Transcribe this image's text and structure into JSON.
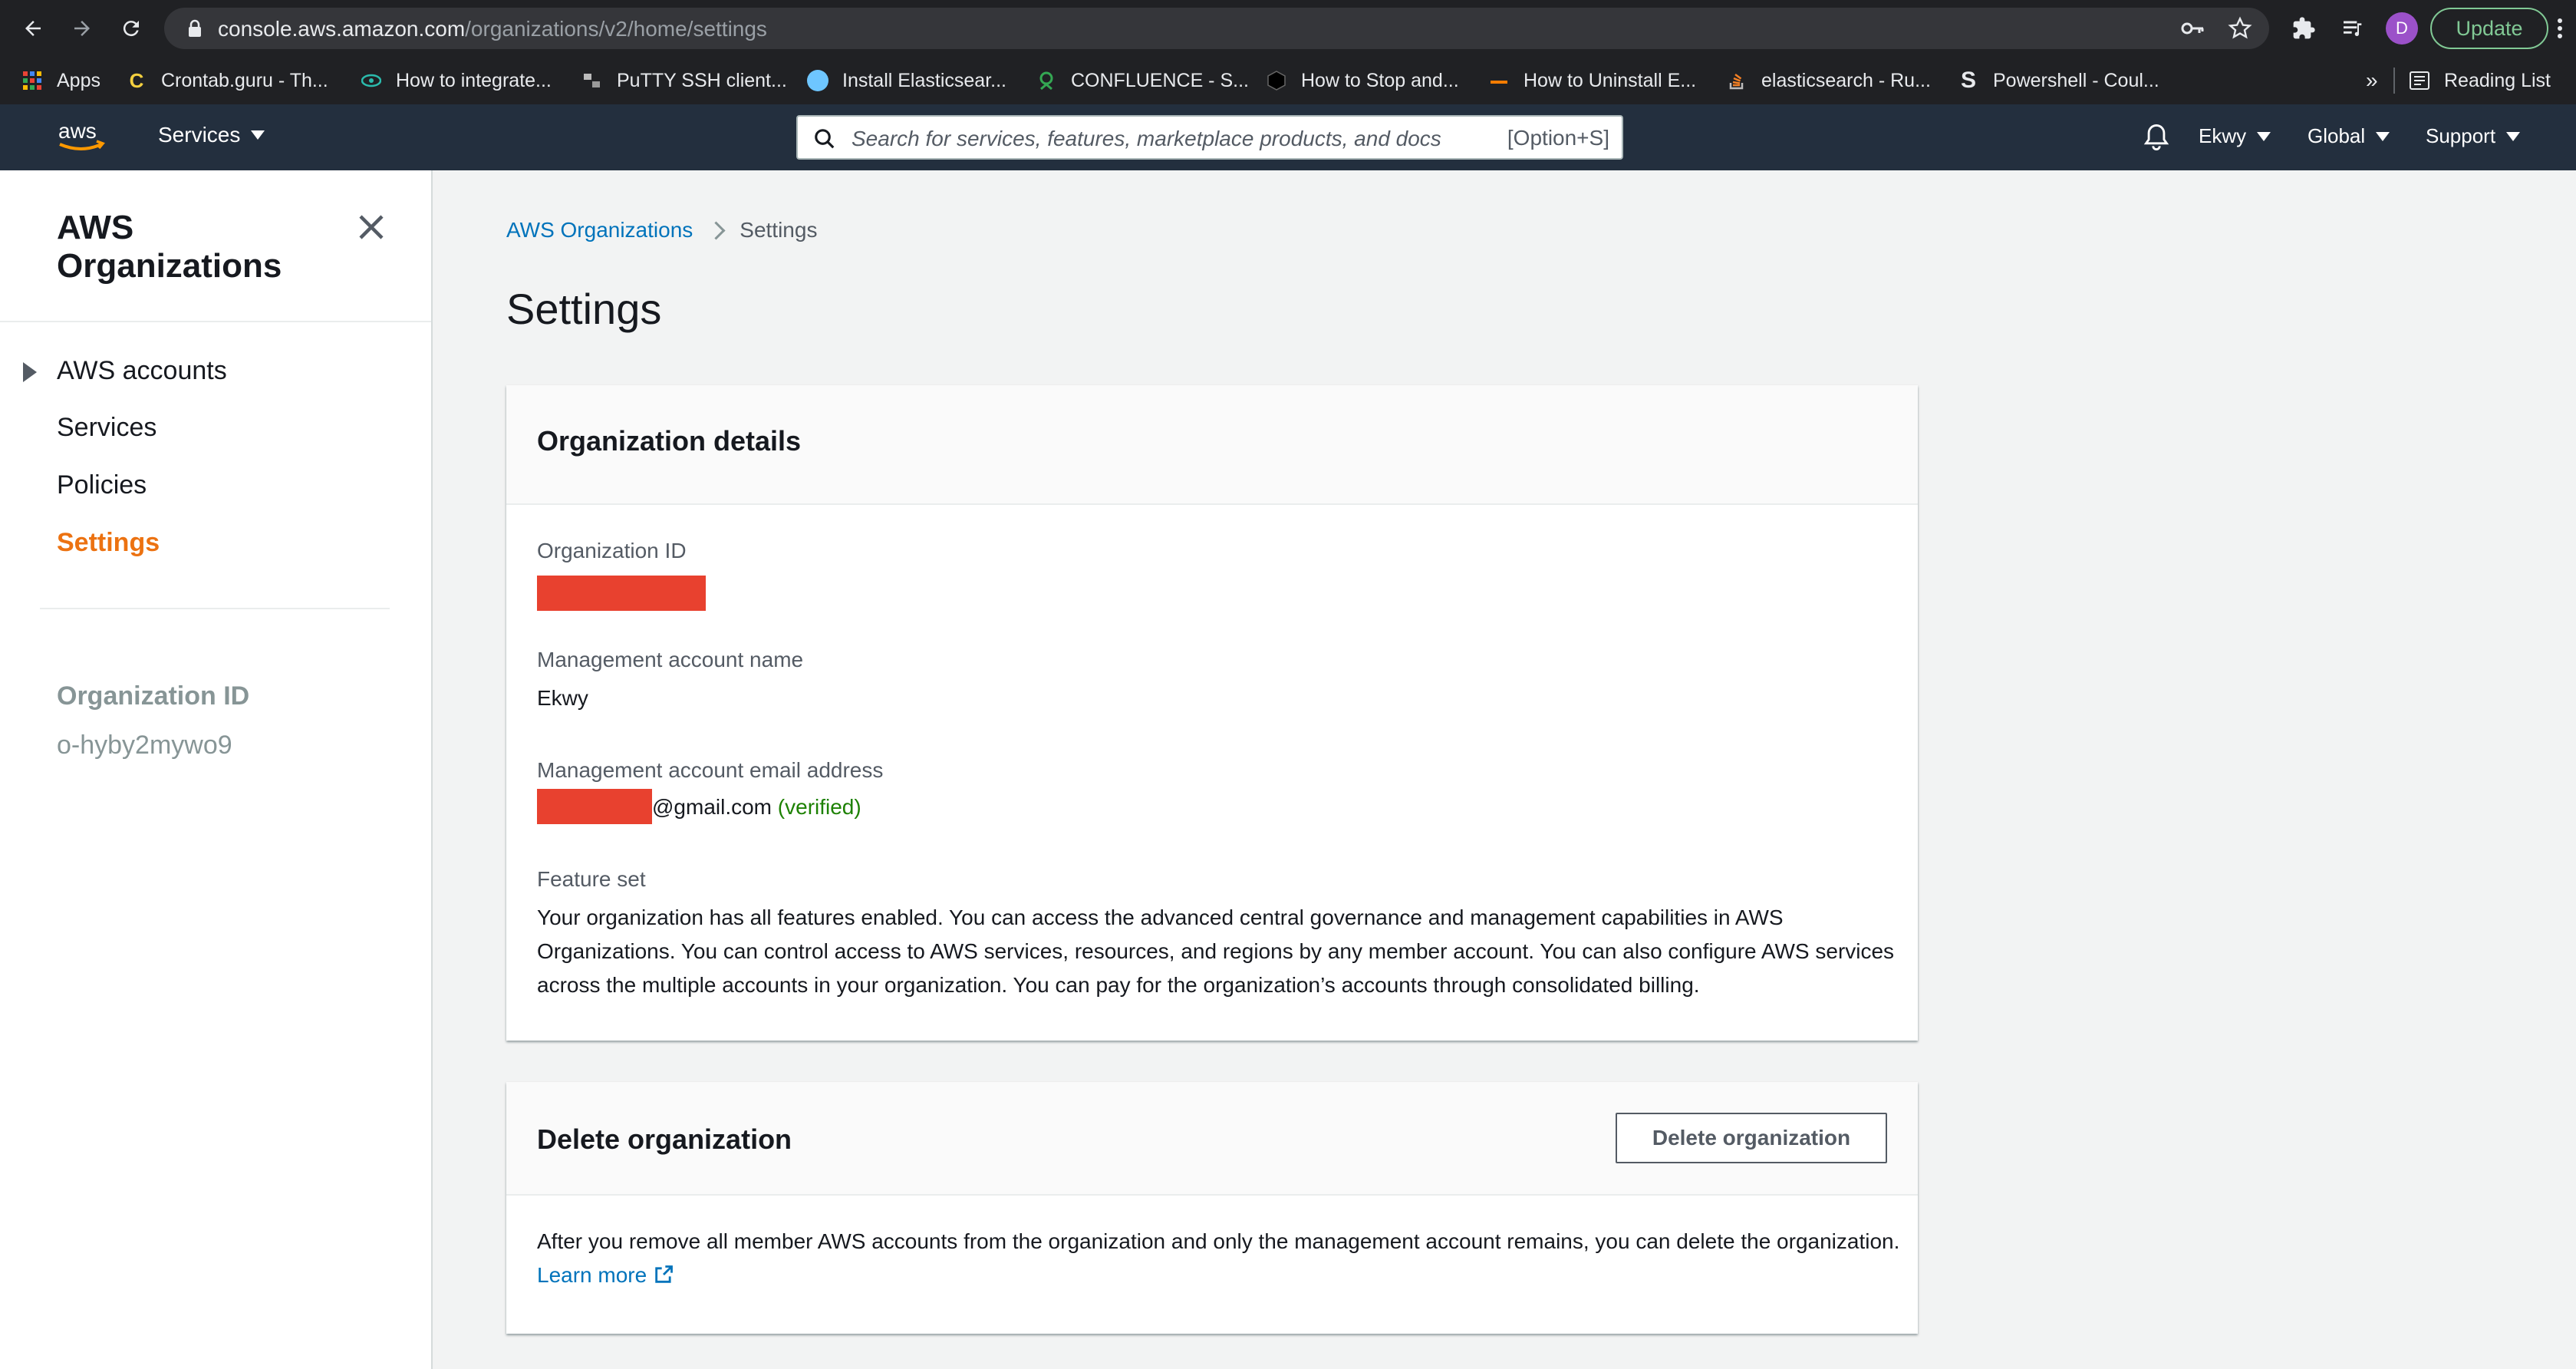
{
  "browser": {
    "url_host": "console.aws.amazon.com",
    "url_path": "/organizations/v2/home/settings",
    "avatar_letter": "D",
    "update_label": "Update",
    "bookmarks": [
      {
        "label": "Apps",
        "icon": "apps-grid-icon",
        "color": "#ea4335"
      },
      {
        "label": "Crontab.guru - Th...",
        "icon": "crontab-icon",
        "color": "#f4d03f"
      },
      {
        "label": "How to integrate...",
        "icon": "eye-icon",
        "color": "#2bbbad"
      },
      {
        "label": "PuTTY SSH client...",
        "icon": "putty-icon",
        "color": "#cccccc"
      },
      {
        "label": "Install Elasticsear...",
        "icon": "elastic-icon",
        "color": "#6ec6ff"
      },
      {
        "label": "CONFLUENCE - S...",
        "icon": "confluence-icon",
        "color": "#34a853"
      },
      {
        "label": "How to Stop and...",
        "icon": "hexagon-icon",
        "color": "#111111"
      },
      {
        "label": "How to Uninstall E...",
        "icon": "dash-icon",
        "color": "#f57c00"
      },
      {
        "label": "elasticsearch - Ru...",
        "icon": "stackoverflow-icon",
        "color": "#f48024"
      },
      {
        "label": "Powershell - Coul...",
        "icon": "s-logo-icon",
        "color": "#e8eaed"
      }
    ],
    "overflow_label": "»",
    "reading_list_label": "Reading List"
  },
  "aws_nav": {
    "services_label": "Services",
    "search_placeholder": "Search for services, features, marketplace products, and docs",
    "search_hint": "[Option+S]",
    "account_label": "Ekwy",
    "region_label": "Global",
    "support_label": "Support"
  },
  "sidebar": {
    "title": "AWS Organizations",
    "items": [
      {
        "label": "AWS accounts"
      },
      {
        "label": "Services"
      },
      {
        "label": "Policies"
      },
      {
        "label": "Settings"
      }
    ],
    "org_id_label": "Organization ID",
    "org_id_value": "o-hyby2mywo9"
  },
  "breadcrumb": {
    "root": "AWS Organizations",
    "current": "Settings"
  },
  "page_title": "Settings",
  "org_details": {
    "heading": "Organization details",
    "org_id_label": "Organization ID",
    "mgmt_name_label": "Management account name",
    "mgmt_name_value": "Ekwy",
    "mgmt_email_label": "Management account email address",
    "mgmt_email_suffix": "@gmail.com",
    "mgmt_email_status": "(verified)",
    "feature_set_label": "Feature set",
    "feature_set_text": "Your organization has all features enabled. You can access the advanced central governance and management capabilities in AWS Organizations. You can control access to AWS services, resources, and regions by any member account. You can also configure AWS services across the multiple accounts in your organization. You can pay for the organization’s accounts through consolidated billing."
  },
  "delete_org": {
    "heading": "Delete organization",
    "button_label": "Delete organization",
    "text": "After you remove all member AWS accounts from the organization and only the management account remains, you can delete the organization.",
    "learn_more": "Learn more"
  },
  "colors": {
    "aws_nav_bg": "#232f3e",
    "accent_orange": "#ec7211",
    "link_blue": "#0073bb",
    "verified_green": "#1d8102",
    "redaction_red": "#e8412f"
  }
}
